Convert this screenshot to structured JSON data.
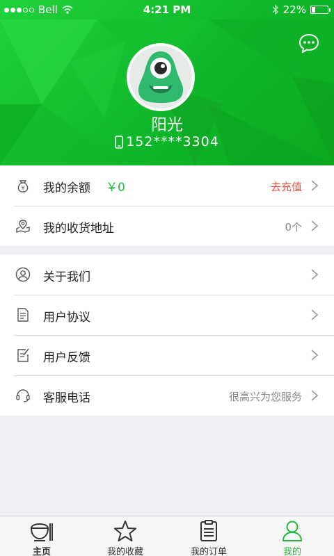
{
  "status_bar": {
    "carrier": "Bell",
    "time": "4:21 PM",
    "battery": "22%",
    "battery_level": 0.22
  },
  "profile": {
    "name": "阳光",
    "phone": "152****3304"
  },
  "account_group": [
    {
      "label": "我的余额",
      "balance": "￥0",
      "right": "去充值",
      "icon": "money-bag-icon"
    },
    {
      "label": "我的收货地址",
      "right": "0个",
      "icon": "location-map-icon"
    }
  ],
  "info_group": [
    {
      "label": "关于我们",
      "icon": "user-circle-icon"
    },
    {
      "label": "用户协议",
      "icon": "document-icon"
    },
    {
      "label": "用户反馈",
      "icon": "edit-note-icon"
    },
    {
      "label": "客服电话",
      "right": "很高兴为您服务",
      "icon": "headset-icon"
    }
  ],
  "tabs": [
    {
      "label": "主页",
      "icon": "home-bowl-icon"
    },
    {
      "label": "我的收藏",
      "icon": "star-icon"
    },
    {
      "label": "我的订单",
      "icon": "clipboard-icon"
    },
    {
      "label": "我的",
      "icon": "user-icon",
      "active": true
    }
  ],
  "colors": {
    "brand_green": "#1fc33a",
    "recharge_red": "#f0503c"
  }
}
